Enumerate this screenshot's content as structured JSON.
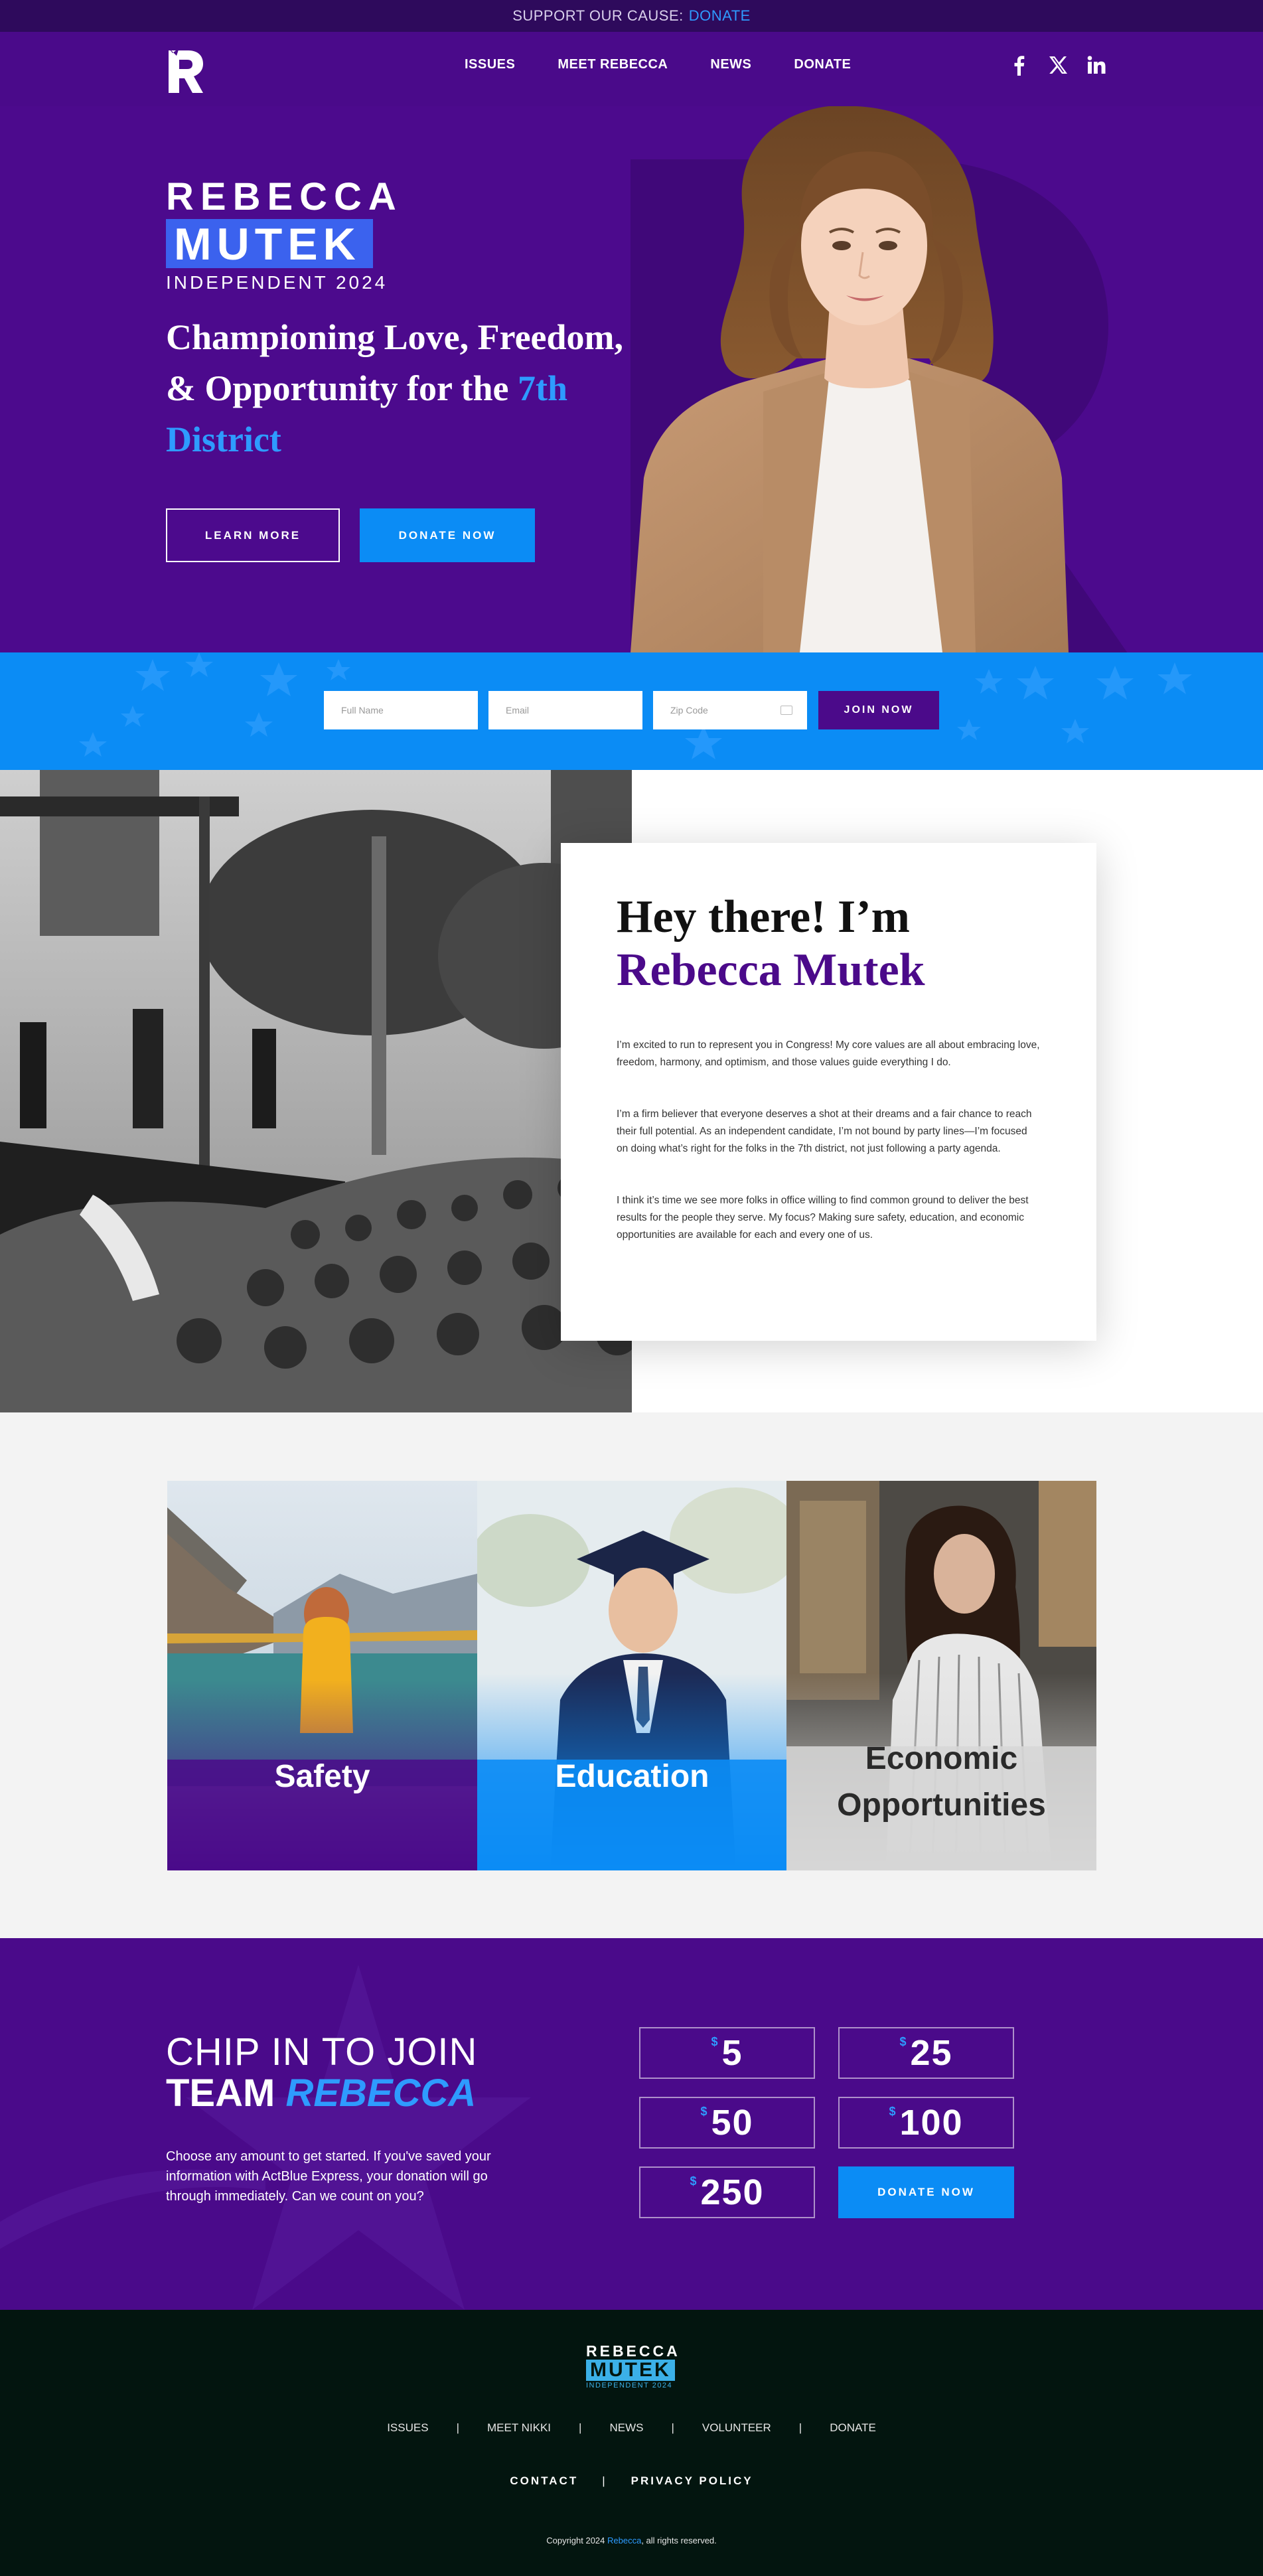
{
  "topbar": {
    "text": "SUPPORT OUR CAUSE:",
    "link": "DONATE"
  },
  "nav": {
    "items": [
      "ISSUES",
      "MEET REBECCA",
      "NEWS",
      "DONATE"
    ]
  },
  "socials": [
    "facebook-icon",
    "x-icon",
    "linkedin-icon"
  ],
  "hero": {
    "first_name": "REBECCA",
    "last_name": "MUTEK",
    "subtitle": "INDEPENDENT 2024",
    "headline_pre": "Championing Love, Freedom, & Opportunity for the",
    "headline_highlight": "7th District",
    "learn_more": "LEARN MORE",
    "donate_now": "DONATE NOW"
  },
  "signup": {
    "name_placeholder": "Full Name",
    "email_placeholder": "Email",
    "zip_placeholder": "Zip Code",
    "join_label": "JOIN NOW"
  },
  "about": {
    "greeting": "Hey there! I’m",
    "name": "Rebecca Mutek",
    "paragraphs": [
      "I’m excited to run to represent you in Congress! My core values are all about embracing love, freedom, harmony, and optimism, and those values guide everything I do.",
      "I’m a firm believer that everyone deserves a shot at their dreams and a fair chance to reach their full potential. As an independent candidate, I’m not bound by party lines—I’m focused on doing what’s right for the folks in the 7th district, not just following a party agenda.",
      "I think it’s time we see more folks in office willing to find common ground to deliver the best results for the people they serve. My focus? Making sure safety, education, and economic opportunities are available for each and every one of us."
    ]
  },
  "issues": {
    "safety": "Safety",
    "education": "Education",
    "economic_1": "Economic",
    "economic_2": "Opportunities"
  },
  "donate": {
    "chip_line": "CHIP IN TO JOIN",
    "team_word": "TEAM",
    "team_name": "REBECCA",
    "copy": "Choose any amount to get started. If you've saved your information with ActBlue Express, your donation will go through immediately. Can we count on you?",
    "currency": "$",
    "amounts": [
      "5",
      "25",
      "50",
      "100",
      "250"
    ],
    "button": "DONATE NOW"
  },
  "footer": {
    "first_name": "REBECCA",
    "last_name": "MUTEK",
    "subtitle": "INDEPENDENT 2024",
    "nav": [
      "ISSUES",
      "MEET NIKKI",
      "NEWS",
      "VOLUNTEER",
      "DONATE"
    ],
    "separator": "|",
    "legal": [
      "CONTACT",
      "PRIVACY POLICY"
    ],
    "copyright_pre": "Copyright 2024",
    "copyright_name": "Rebecca",
    "copyright_post": ", all rights reserved."
  },
  "colors": {
    "purple": "#4a0a8a",
    "dark_purple": "#2e0a5c",
    "blue": "#0b8cf5",
    "highlight_blue": "#2e9bff",
    "footer_bg": "#03150f"
  }
}
